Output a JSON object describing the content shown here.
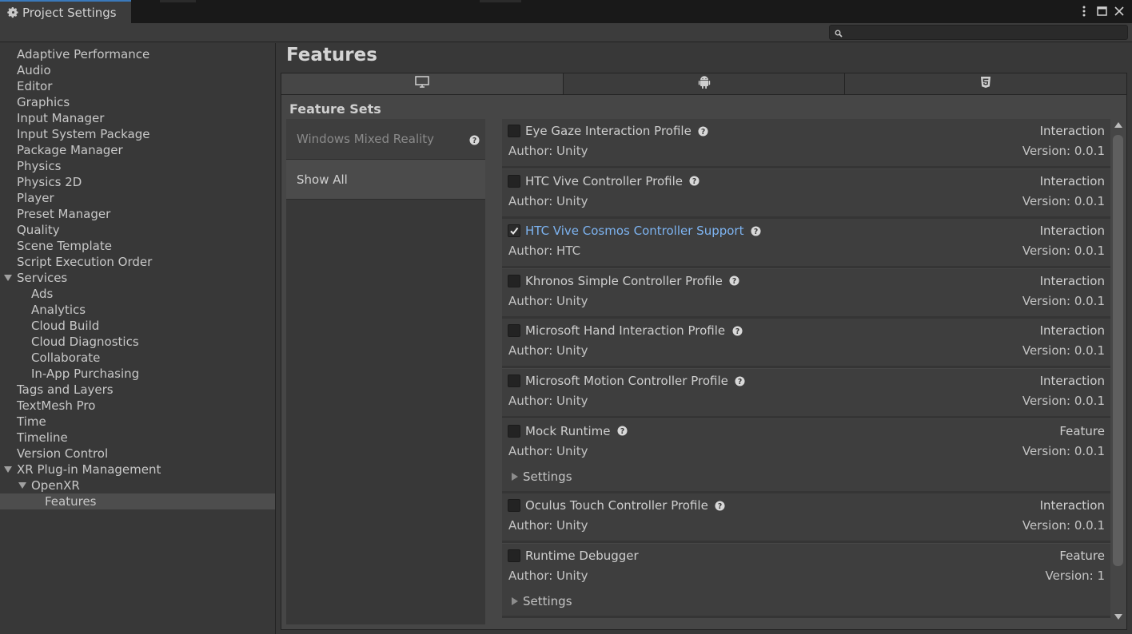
{
  "window": {
    "tab_title": "Project Settings",
    "tab_icon": "gear-icon"
  },
  "search": {
    "placeholder": "",
    "value": ""
  },
  "sidebar": {
    "items": [
      {
        "label": "Adaptive Performance",
        "level": 0
      },
      {
        "label": "Audio",
        "level": 0
      },
      {
        "label": "Editor",
        "level": 0
      },
      {
        "label": "Graphics",
        "level": 0
      },
      {
        "label": "Input Manager",
        "level": 0
      },
      {
        "label": "Input System Package",
        "level": 0
      },
      {
        "label": "Package Manager",
        "level": 0
      },
      {
        "label": "Physics",
        "level": 0
      },
      {
        "label": "Physics 2D",
        "level": 0
      },
      {
        "label": "Player",
        "level": 0
      },
      {
        "label": "Preset Manager",
        "level": 0
      },
      {
        "label": "Quality",
        "level": 0
      },
      {
        "label": "Scene Template",
        "level": 0
      },
      {
        "label": "Script Execution Order",
        "level": 0
      },
      {
        "label": "Services",
        "level": 0,
        "expanded": true
      },
      {
        "label": "Ads",
        "level": 1
      },
      {
        "label": "Analytics",
        "level": 1
      },
      {
        "label": "Cloud Build",
        "level": 1
      },
      {
        "label": "Cloud Diagnostics",
        "level": 1
      },
      {
        "label": "Collaborate",
        "level": 1
      },
      {
        "label": "In-App Purchasing",
        "level": 1
      },
      {
        "label": "Tags and Layers",
        "level": 0
      },
      {
        "label": "TextMesh Pro",
        "level": 0
      },
      {
        "label": "Time",
        "level": 0
      },
      {
        "label": "Timeline",
        "level": 0
      },
      {
        "label": "Version Control",
        "level": 0
      },
      {
        "label": "XR Plug-in Management",
        "level": 0,
        "expanded": true
      },
      {
        "label": "OpenXR",
        "level": 1,
        "expanded": true
      },
      {
        "label": "Features",
        "level": 2,
        "selected": true
      }
    ]
  },
  "main": {
    "title": "Features",
    "platform_tabs": [
      {
        "icon": "desktop-icon",
        "active": true
      },
      {
        "icon": "android-icon",
        "active": false
      },
      {
        "icon": "html5-icon",
        "active": false
      }
    ],
    "feature_sets_title": "Feature Sets",
    "feature_sets": [
      {
        "label": "Windows Mixed Reality",
        "disabled": true
      },
      {
        "label": "Show All",
        "selected": true
      }
    ],
    "features": [
      {
        "name": "Eye Gaze Interaction Profile",
        "type": "Interaction",
        "author": "Author: Unity",
        "version": "Version: 0.0.1",
        "checked": false,
        "help": true
      },
      {
        "name": "HTC Vive Controller Profile",
        "type": "Interaction",
        "author": "Author: Unity",
        "version": "Version: 0.0.1",
        "checked": false,
        "help": true
      },
      {
        "name": "HTC Vive Cosmos Controller Support",
        "type": "Interaction",
        "author": "Author: HTC",
        "version": "Version: 0.0.1",
        "checked": true,
        "help": true
      },
      {
        "name": "Khronos Simple Controller Profile",
        "type": "Interaction",
        "author": "Author: Unity",
        "version": "Version: 0.0.1",
        "checked": false,
        "help": true
      },
      {
        "name": "Microsoft Hand Interaction Profile",
        "type": "Interaction",
        "author": "Author: Unity",
        "version": "Version: 0.0.1",
        "checked": false,
        "help": true
      },
      {
        "name": "Microsoft Motion Controller Profile",
        "type": "Interaction",
        "author": "Author: Unity",
        "version": "Version: 0.0.1",
        "checked": false,
        "help": true
      },
      {
        "name": "Mock Runtime",
        "type": "Feature",
        "author": "Author: Unity",
        "version": "Version: 0.0.1",
        "checked": false,
        "help": true,
        "settings": "Settings"
      },
      {
        "name": "Oculus Touch Controller Profile",
        "type": "Interaction",
        "author": "Author: Unity",
        "version": "Version: 0.0.1",
        "checked": false,
        "help": true
      },
      {
        "name": "Runtime Debugger",
        "type": "Feature",
        "author": "Author: Unity",
        "version": "Version: 1",
        "checked": false,
        "help": false,
        "settings": "Settings"
      }
    ]
  },
  "colors": {
    "accent_tab": "#3a79bb",
    "highlight_text": "#7db3f0",
    "background": "#383838",
    "panel": "#464646"
  }
}
